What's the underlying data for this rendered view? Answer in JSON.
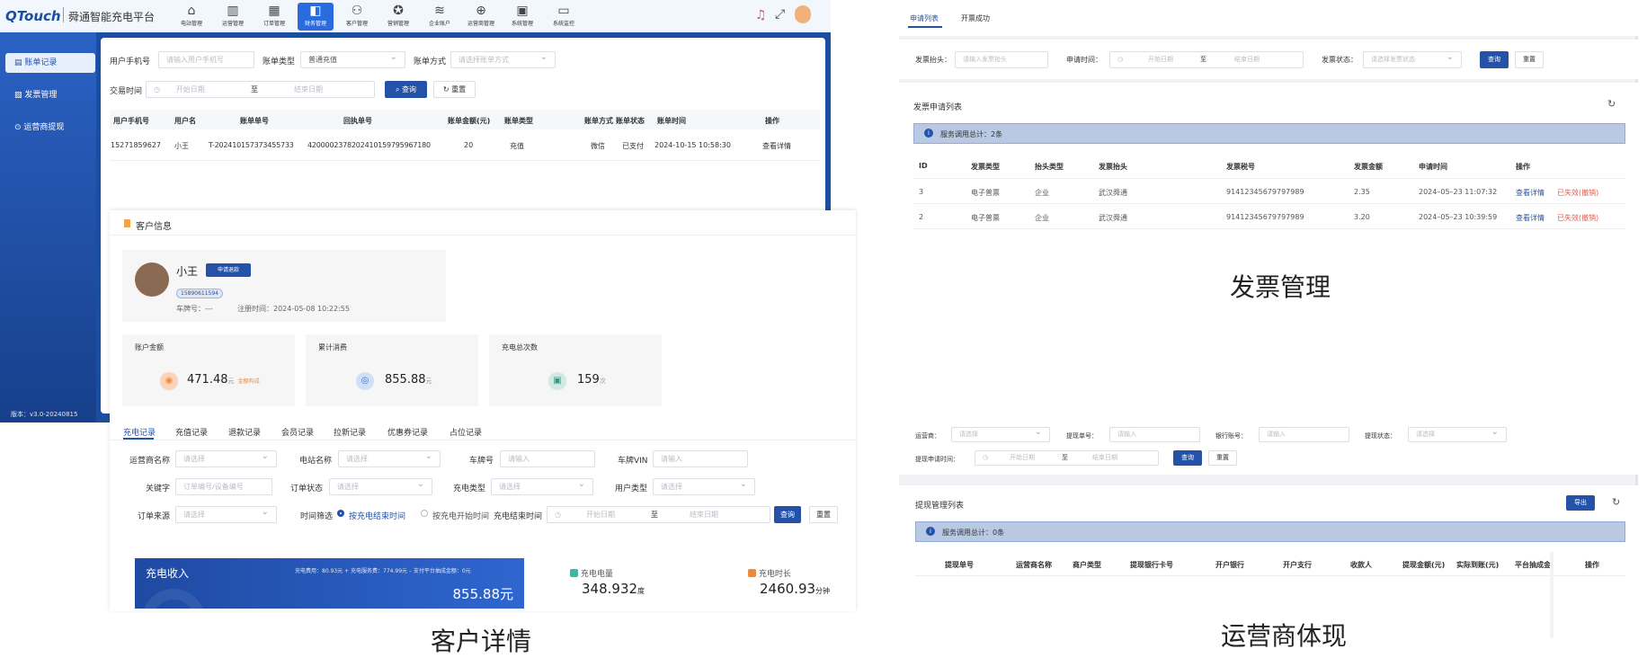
{
  "brand": {
    "logo": "QTouch",
    "name": "舜通智能充电平台"
  },
  "nav": [
    {
      "label": "电站管理",
      "icon": "station-icon"
    },
    {
      "label": "运营管理",
      "icon": "chart-icon"
    },
    {
      "label": "订单管理",
      "icon": "order-icon"
    },
    {
      "label": "财务管理",
      "icon": "finance-icon",
      "active": true
    },
    {
      "label": "客户管理",
      "icon": "users-icon"
    },
    {
      "label": "营销管理",
      "icon": "marketing-icon"
    },
    {
      "label": "企业账户",
      "icon": "enterprise-icon"
    },
    {
      "label": "运营商管理",
      "icon": "operator-icon"
    },
    {
      "label": "系统管理",
      "icon": "system-icon"
    },
    {
      "label": "系统监控",
      "icon": "monitor-icon"
    }
  ],
  "sidebar": {
    "items": [
      {
        "label": "账单记录",
        "active": true
      },
      {
        "label": "发票管理"
      },
      {
        "label": "运营商提现"
      }
    ],
    "version": "版本：v3.0-20240815"
  },
  "billing": {
    "filters": {
      "phone_label": "用户手机号",
      "phone_ph": "请输入用户手机号",
      "type_label": "账单类型",
      "type_value": "普通充值",
      "method_label": "账单方式",
      "method_ph": "请选择账单方式",
      "time_label": "交易时间",
      "start_ph": "开始日期",
      "to": "至",
      "end_ph": "结束日期",
      "search": "查询",
      "reset": "重置"
    },
    "columns": [
      "用户手机号",
      "用户名",
      "账单单号",
      "回执单号",
      "账单金额(元)",
      "账单类型",
      "账单方式",
      "账单状态",
      "账单时间",
      "操作"
    ],
    "rows": [
      [
        "15271859627",
        "小王",
        "T-20241015737345573 3",
        "4200002378202410159795967180",
        "20",
        "充值",
        "微信",
        "已支付",
        "2024-10-15 10:58:30",
        "查看详情"
      ]
    ]
  },
  "customer": {
    "title": "客户信息",
    "name": "小王",
    "apply_btn": "申请退款",
    "phone": "15890611594",
    "plate": "车牌号：---",
    "reg": "注册时间：2024-05-08 10:22:55",
    "stats": [
      {
        "label": "账户金额",
        "value": "471.48",
        "unit": "元",
        "extra": "金额构成"
      },
      {
        "label": "累计消费",
        "value": "855.88",
        "unit": "元"
      },
      {
        "label": "充电总次数",
        "value": "159",
        "unit": "次"
      }
    ],
    "tabs": [
      "充电记录",
      "充值记录",
      "退款记录",
      "会员记录",
      "拉新记录",
      "优惠券记录",
      "占位记录"
    ],
    "filters": {
      "operator": "运营商名称",
      "station": "电站名称",
      "plate": "车牌号",
      "vin": "车牌VIN",
      "keyword": "关键字",
      "order_status": "订单状态",
      "charge_type": "充电类型",
      "user_type": "用户类型",
      "source": "订单来源",
      "time_filter": "时间筛选",
      "opt1": "按充电结束时间",
      "opt2": "按充电开始时间",
      "end_time": "充电结束时间",
      "select_ph": "请选择",
      "input_ph": "请输入",
      "keyword_ph": "订单编号/设备编号",
      "start": "开始日期",
      "to": "至",
      "end": "结束日期",
      "search": "查询",
      "reset": "重置"
    },
    "income": {
      "title": "充电收入",
      "detail": "充电费用：80.93元 + 充电服务费：774.99元 – 支付平台抽成金额：0元",
      "value": "855.88元"
    },
    "energy": {
      "label": "充电电量",
      "value": "348.932",
      "unit": "度"
    },
    "duration": {
      "label": "充电时长",
      "value": "2460.93",
      "unit": "分钟"
    },
    "caption": "客户详情"
  },
  "invoice": {
    "tabs": [
      "申请列表",
      "开票成功"
    ],
    "filters": {
      "head_label": "发票抬头：",
      "head_ph": "请输入发票抬头",
      "time_label": "申请时间：",
      "start": "开始日期",
      "to": "至",
      "end": "结束日期",
      "status_label": "发票状态：",
      "status_ph": "请选择发票状态",
      "search": "查询",
      "reset": "重置"
    },
    "list_title": "发票申请列表",
    "summary": "服务调用总计：2条",
    "columns": [
      "ID",
      "发票类型",
      "抬头类型",
      "发票抬头",
      "发票税号",
      "发票金额",
      "申请时间",
      "操作"
    ],
    "rows": [
      [
        "3",
        "电子普票",
        "企业",
        "武汉舜通",
        "91412345679797989",
        "2.35",
        "2024–05–23 11:07:32",
        "查看详情",
        "已失效(撤销)"
      ],
      [
        "2",
        "电子普票",
        "企业",
        "武汉舜通",
        "91412345679797989",
        "3.20",
        "2024–05–23 10:39:59",
        "查看详情",
        "已失效(撤销)"
      ]
    ],
    "caption": "发票管理"
  },
  "withdraw": {
    "filters": {
      "operator": "运营商：",
      "operator_ph": "请选择",
      "no": "提现单号：",
      "no_ph": "请输入",
      "bank": "银行账号：",
      "bank_ph": "请输入",
      "status": "提现状态：",
      "status_ph": "请选择",
      "time": "提现申请时间：",
      "start": "开始日期",
      "to": "至",
      "end": "结束日期",
      "search": "查询",
      "reset": "重置"
    },
    "list_title": "提现管理列表",
    "export": "导出",
    "summary": "服务调用总计：0条",
    "columns": [
      "提现单号",
      "运营商名称",
      "商户类型",
      "提现银行卡号",
      "开户银行",
      "开户支行",
      "收款人",
      "提现金额(元)",
      "实际到账(元)",
      "平台抽成金",
      "操作"
    ],
    "caption": "运营商体现"
  }
}
